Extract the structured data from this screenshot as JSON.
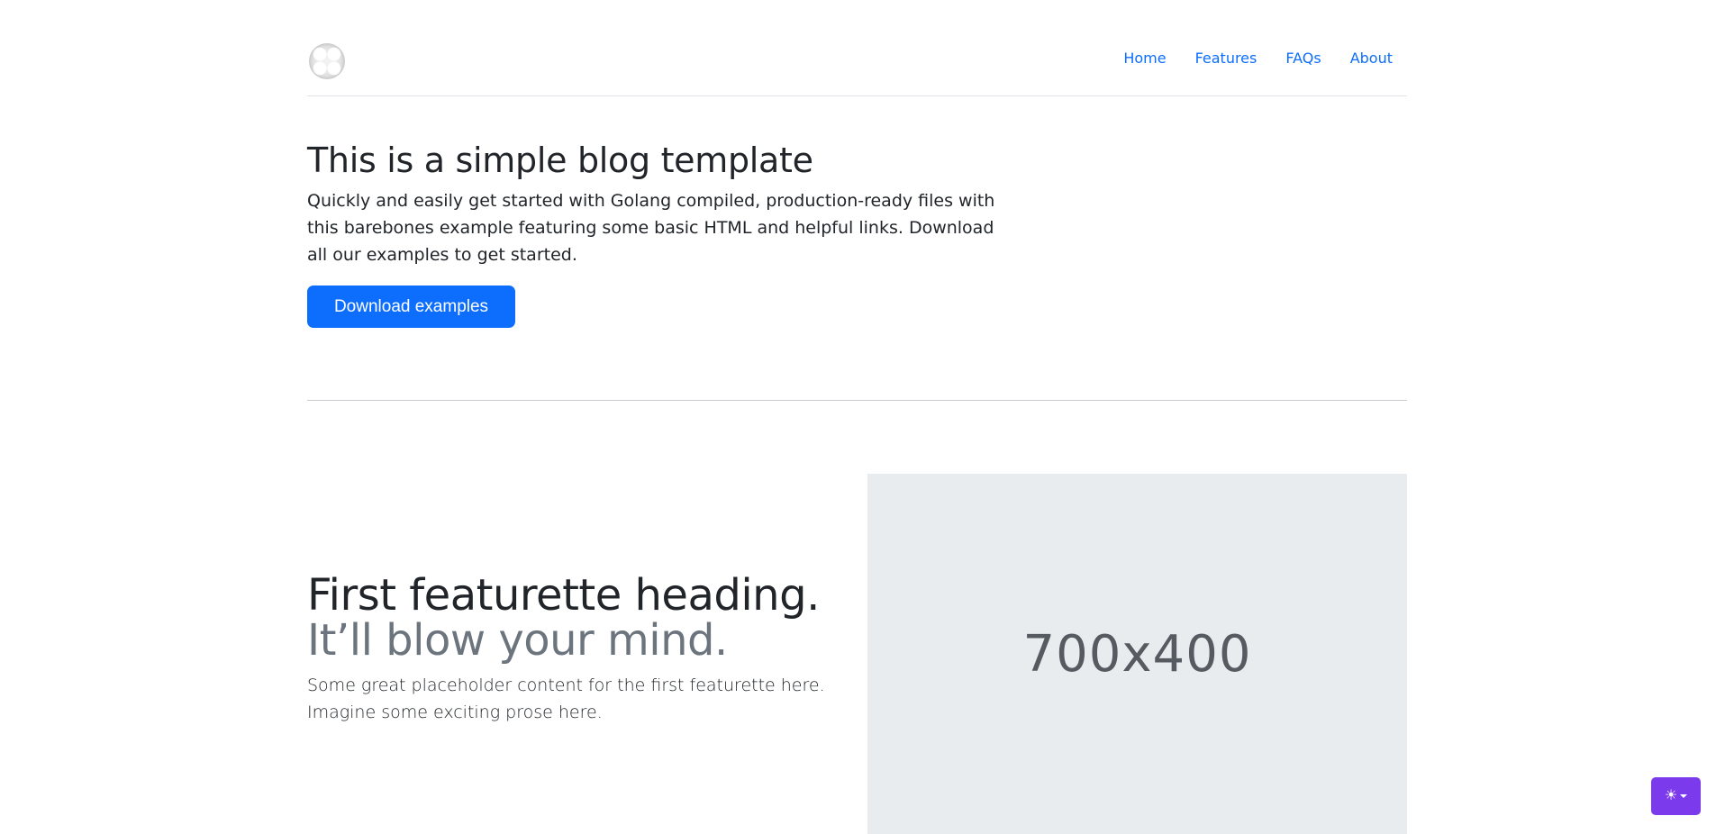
{
  "header": {
    "nav": [
      {
        "label": "Home"
      },
      {
        "label": "Features"
      },
      {
        "label": "FAQs"
      },
      {
        "label": "About"
      }
    ]
  },
  "hero": {
    "title": "This is a simple blog template",
    "description": "Quickly and easily get started with Golang compiled, production-ready files with this barebones example featuring some basic HTML and helpful links. Download all our examples to get started.",
    "button_label": "Download examples"
  },
  "featurette": {
    "heading": "First featurette heading.",
    "heading_muted": "It’ll blow your mind.",
    "body": "Some great placeholder content for the first featurette here. Imagine some exciting prose here.",
    "image_label": "700x400"
  },
  "theme_toggle": {
    "icon": "sun-icon"
  },
  "colors": {
    "primary": "#0d6efd",
    "theme_toggle": "#7c3aed",
    "placeholder_bg": "#e9ecef"
  }
}
